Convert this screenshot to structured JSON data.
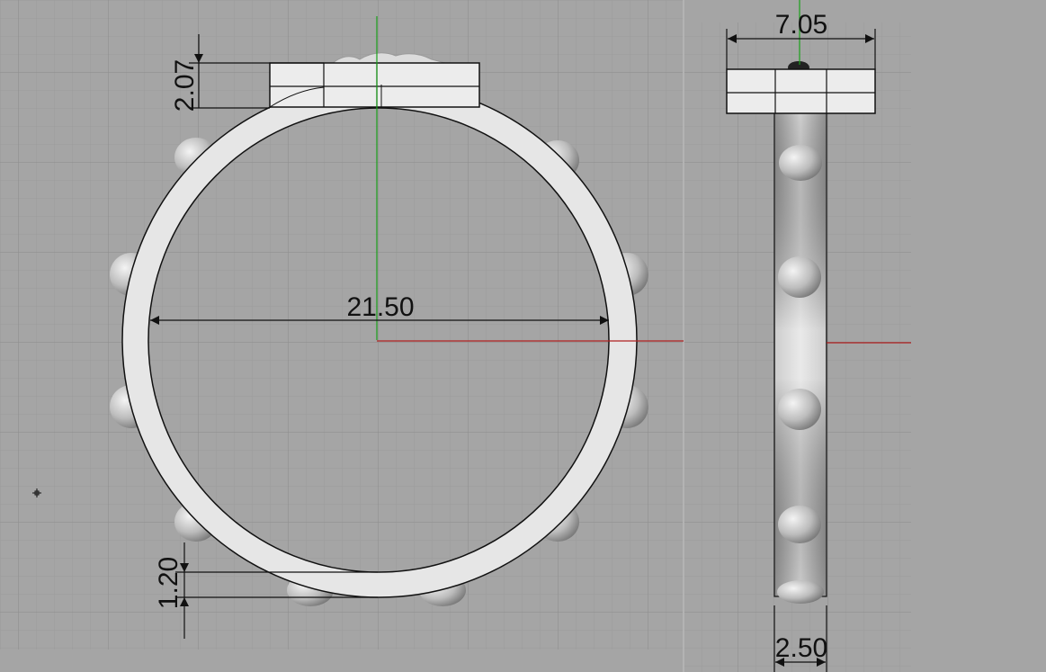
{
  "colors": {
    "background": "#a5a5a5",
    "grid_minor": "#9b9b9b",
    "grid_major": "#8a8a8a",
    "x_axis": "#b02020",
    "y_axis": "#1aa01a",
    "ring_fill": "#e6e6e6",
    "outline": "#111111"
  },
  "front_view": {
    "dimensions": {
      "inner_diameter": "21.50",
      "top_height": "2.07",
      "band_thickness": "1.20"
    }
  },
  "side_view": {
    "dimensions": {
      "top_width": "7.05",
      "band_width": "2.50"
    }
  },
  "icons": {
    "cursor": "crosshair-cursor-icon"
  }
}
